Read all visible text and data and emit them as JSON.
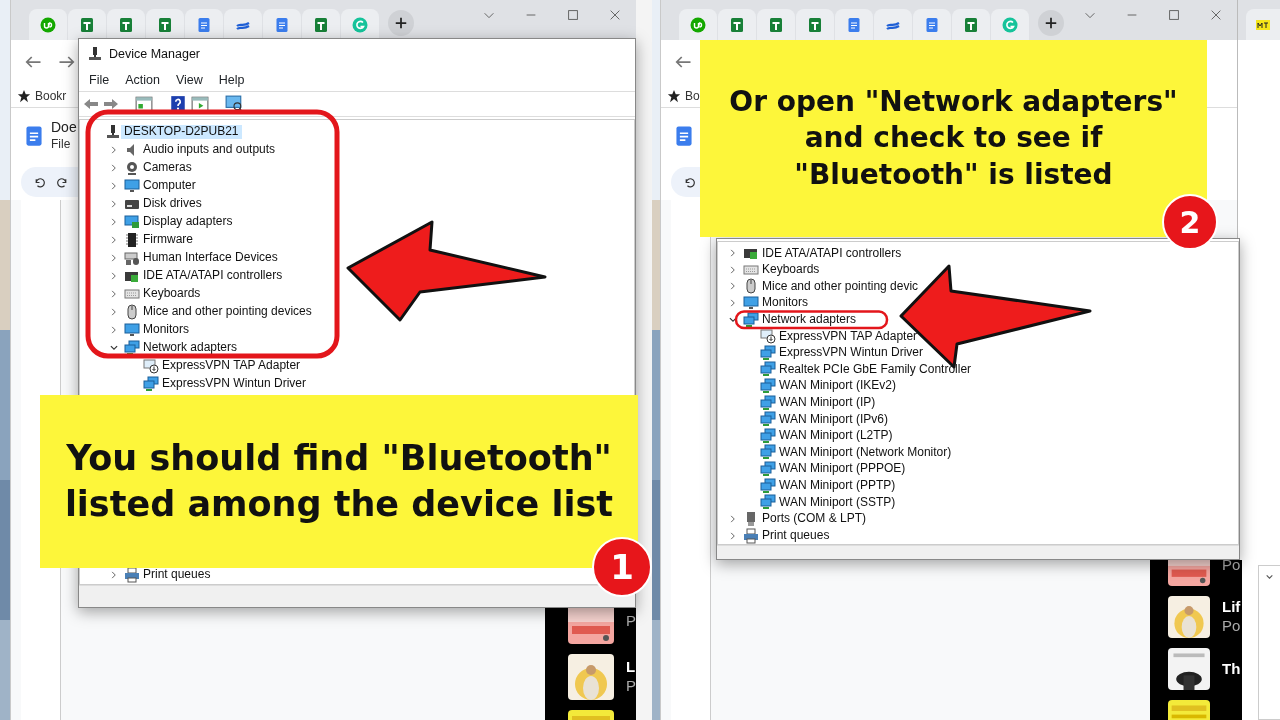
{
  "panels": [
    {
      "browser": {
        "tabs": [
          {
            "kind": "upwork"
          },
          {
            "kind": "sheets"
          },
          {
            "kind": "sheets"
          },
          {
            "kind": "sheets"
          },
          {
            "kind": "docs"
          },
          {
            "kind": "wave"
          },
          {
            "kind": "docs"
          },
          {
            "kind": "sheets"
          },
          {
            "kind": "grammarly"
          }
        ],
        "bookmarks_label": "Bookr",
        "document": {
          "title": "Doe",
          "menu": "File"
        }
      },
      "device_manager": {
        "title": "Device Manager",
        "menu": [
          "File",
          "Action",
          "View",
          "Help"
        ],
        "tree": [
          {
            "label": "DESKTOP-D2PUB21",
            "kind": "host",
            "selected": true,
            "children": [
              {
                "label": "Audio inputs and outputs",
                "kind": "speaker",
                "expanded": false
              },
              {
                "label": "Cameras",
                "kind": "camera",
                "expanded": false
              },
              {
                "label": "Computer",
                "kind": "monitor",
                "expanded": false
              },
              {
                "label": "Disk drives",
                "kind": "disk",
                "expanded": false
              },
              {
                "label": "Display adapters",
                "kind": "display",
                "expanded": false
              },
              {
                "label": "Firmware",
                "kind": "chip",
                "expanded": false
              },
              {
                "label": "Human Interface Devices",
                "kind": "hid",
                "expanded": false
              },
              {
                "label": "IDE ATA/ATAPI controllers",
                "kind": "ide",
                "expanded": false
              },
              {
                "label": "Keyboards",
                "kind": "keyboard",
                "expanded": false
              },
              {
                "label": "Mice and other pointing devices",
                "kind": "mouse",
                "expanded": false
              },
              {
                "label": "Monitors",
                "kind": "monitor",
                "expanded": false
              },
              {
                "label": "Network adapters",
                "kind": "network",
                "expanded": true,
                "children": [
                  {
                    "label": "ExpressVPN TAP Adapter",
                    "kind": "tap"
                  },
                  {
                    "label": "ExpressVPN Wintun Driver",
                    "kind": "network"
                  }
                ]
              },
              {
                "label": "Print queues",
                "kind": "printer",
                "expanded": false
              }
            ]
          }
        ]
      },
      "callout": {
        "text": "You should find \"Bluetooth\"\nlisted among the device list",
        "step": "1"
      },
      "sidebar": [
        {
          "kind": "picture",
          "subtitle": "P"
        },
        {
          "kind": "picture",
          "title": "L",
          "subtitle": "P"
        },
        {
          "kind": "picture"
        }
      ]
    },
    {
      "browser": {
        "tabs": [
          {
            "kind": "upwork"
          },
          {
            "kind": "sheets"
          },
          {
            "kind": "sheets"
          },
          {
            "kind": "sheets"
          },
          {
            "kind": "docs"
          },
          {
            "kind": "wave"
          },
          {
            "kind": "docs"
          },
          {
            "kind": "sheets"
          },
          {
            "kind": "grammarly"
          }
        ],
        "bookmarks_label": "Bo"
      },
      "device_manager": {
        "tree": [
          {
            "label": "IDE ATA/ATAPI controllers",
            "kind": "ide",
            "expanded": false
          },
          {
            "label": "Keyboards",
            "kind": "keyboard",
            "expanded": false
          },
          {
            "label": "Mice and other pointing devic",
            "kind": "mouse",
            "expanded": false
          },
          {
            "label": "Monitors",
            "kind": "monitor",
            "expanded": false
          },
          {
            "label": "Network adapters",
            "kind": "network",
            "expanded": true,
            "children": [
              {
                "label": "ExpressVPN TAP Adapter",
                "kind": "tap"
              },
              {
                "label": "ExpressVPN Wintun Driver",
                "kind": "network"
              },
              {
                "label": "Realtek PCIe GbE Family Controller",
                "kind": "network"
              },
              {
                "label": "WAN Miniport (IKEv2)",
                "kind": "network"
              },
              {
                "label": "WAN Miniport (IP)",
                "kind": "network"
              },
              {
                "label": "WAN Miniport (IPv6)",
                "kind": "network"
              },
              {
                "label": "WAN Miniport (L2TP)",
                "kind": "network"
              },
              {
                "label": "WAN Miniport (Network Monitor)",
                "kind": "network"
              },
              {
                "label": "WAN Miniport (PPPOE)",
                "kind": "network"
              },
              {
                "label": "WAN Miniport (PPTP)",
                "kind": "network"
              },
              {
                "label": "WAN Miniport (SSTP)",
                "kind": "network"
              }
            ]
          },
          {
            "label": "Ports (COM & LPT)",
            "kind": "ports",
            "expanded": false
          },
          {
            "label": "Print queues",
            "kind": "printer",
            "expanded": false
          }
        ]
      },
      "callout": {
        "text": "Or open \"Network adapters\"\nand check to see if\n\"Bluetooth\" is listed",
        "step": "2"
      },
      "sidebar": [
        {
          "kind": "picture",
          "subtitle": "Po"
        },
        {
          "kind": "picture",
          "title": "Lif",
          "subtitle": "Po"
        },
        {
          "kind": "picture",
          "title": "Th"
        },
        {
          "kind": "picture"
        }
      ]
    }
  ]
}
